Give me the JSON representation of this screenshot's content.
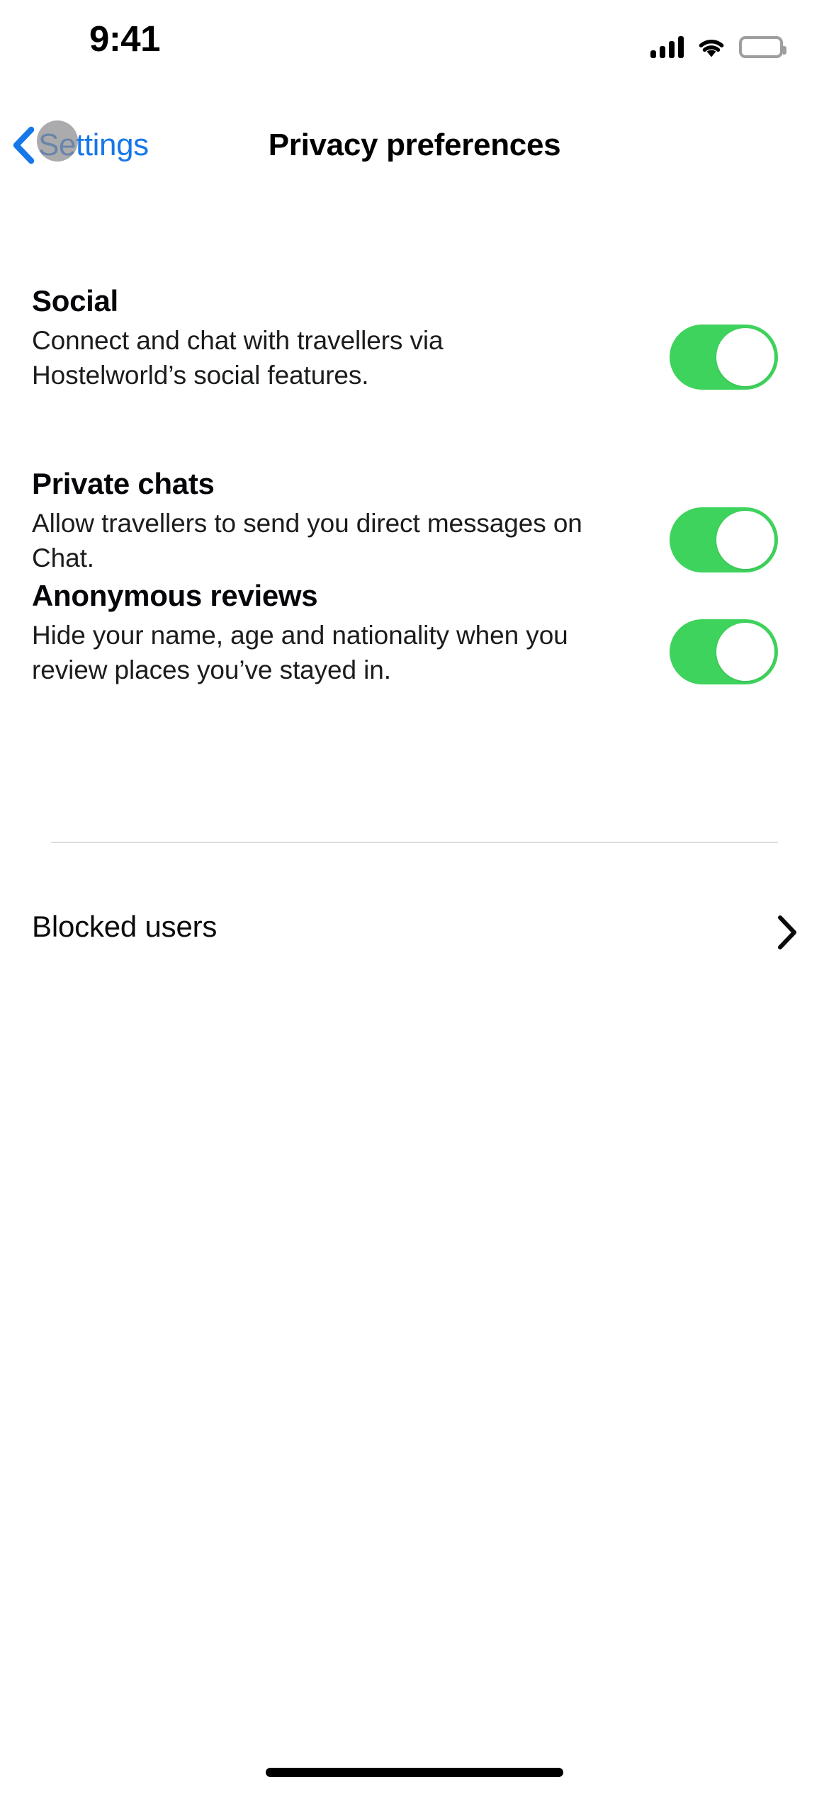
{
  "status_bar": {
    "time": "9:41",
    "cellular_icon": "cellular-signal-icon",
    "wifi_icon": "wifi-icon",
    "battery_icon": "battery-full-icon"
  },
  "nav_bar": {
    "back_icon": "chevron-left-icon",
    "back_label": "Settings",
    "title": "Privacy preferences"
  },
  "colors": {
    "accent_blue": "#1677E8",
    "toggle_on_green": "#3ED35C",
    "divider": "#DCDCDE",
    "text_primary": "#05060A",
    "touch_indicator": "#8A8A8F"
  },
  "preferences": [
    {
      "title": "Social",
      "description": "Connect and chat with travellers via Hostelworld’s social features.",
      "toggle_state": "on",
      "toggle_name": "social-toggle"
    },
    {
      "title": "Private chats",
      "description": "Allow travellers to send you direct messages on Chat.",
      "toggle_state": "on",
      "toggle_name": "private-chats-toggle"
    },
    {
      "title": "Anonymous reviews",
      "description": "Hide your name, age and nationality when you review places you’ve stayed in.",
      "toggle_state": "on",
      "toggle_name": "anonymous-reviews-toggle"
    }
  ],
  "blocked_users": {
    "label": "Blocked users",
    "chevron_icon": "chevron-right-icon"
  },
  "home_indicator": "home-indicator"
}
